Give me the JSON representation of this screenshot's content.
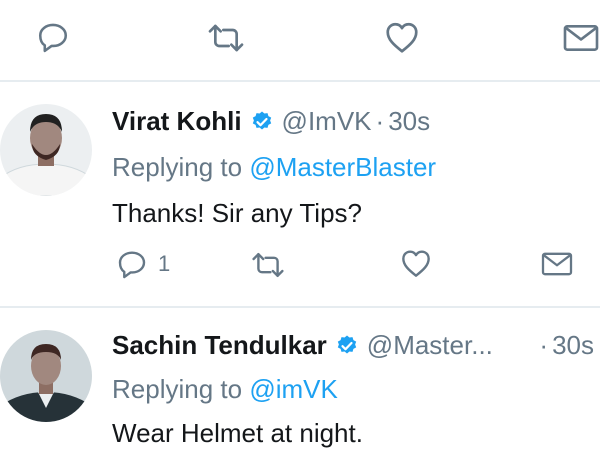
{
  "top_actions": {
    "reply_icon": "reply-icon",
    "retweet_icon": "retweet-icon",
    "like_icon": "heart-icon",
    "message_icon": "envelope-icon"
  },
  "tweets": [
    {
      "name": "Virat Kohli",
      "handle": "@ImVK",
      "separator": "·",
      "time": "30s",
      "replying_prefix": "Replying to ",
      "replying_to": "@MasterBlaster",
      "text": "Thanks! Sir any Tips?",
      "reply_count": "1"
    },
    {
      "name": "Sachin Tendulkar",
      "handle": "@Master...",
      "separator": "·",
      "time": "30s",
      "replying_prefix": "Replying to ",
      "replying_to": "@imVK",
      "text": "Wear Helmet at night."
    }
  ],
  "colors": {
    "link": "#1da1f2",
    "muted": "#657786",
    "text": "#14171a",
    "divider": "#e6ecf0"
  }
}
